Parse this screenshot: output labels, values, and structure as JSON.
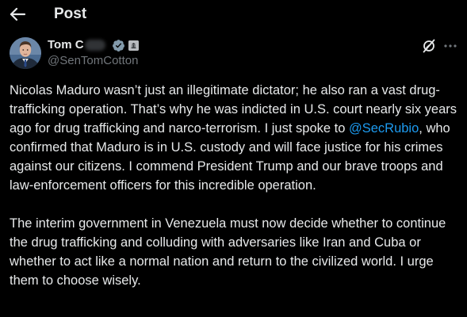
{
  "header": {
    "back_icon": "arrow-left-icon",
    "title": "Post"
  },
  "author": {
    "avatar_icon": "profile-photo",
    "name": "Tom C",
    "handle": "@SenTomCotton",
    "verified_icon": "verified-badge-icon",
    "verified_color": "#829aab",
    "affiliation_icon": "government-badge-icon"
  },
  "actions": {
    "grok_icon": "grok-icon",
    "more_icon": "more-icon"
  },
  "tweet": {
    "paragraph1_before": "Nicolas Maduro wasn’t just an illegitimate dictator; he also ran a vast drug-trafficking operation. That’s why he was indicted in U.S. court nearly six years ago for drug trafficking and narco-terrorism. I just spoke to ",
    "mention": "@SecRubio",
    "paragraph1_after": ", who confirmed that Maduro is in U.S. custody and will face justice for his crimes against our citizens. I commend President Trump and our brave troops and law-enforcement officers for this incredible operation.",
    "paragraph2": "The interim government in Venezuela must now decide whether to continue the drug trafficking and colluding with adversaries like Iran and Cuba or whether to act like a normal nation and return to the civilized world. I urge them to choose wisely."
  },
  "colors": {
    "background": "#000000",
    "text": "#e7e9ea",
    "secondary_text": "#71767b",
    "link": "#1d9bf0"
  }
}
